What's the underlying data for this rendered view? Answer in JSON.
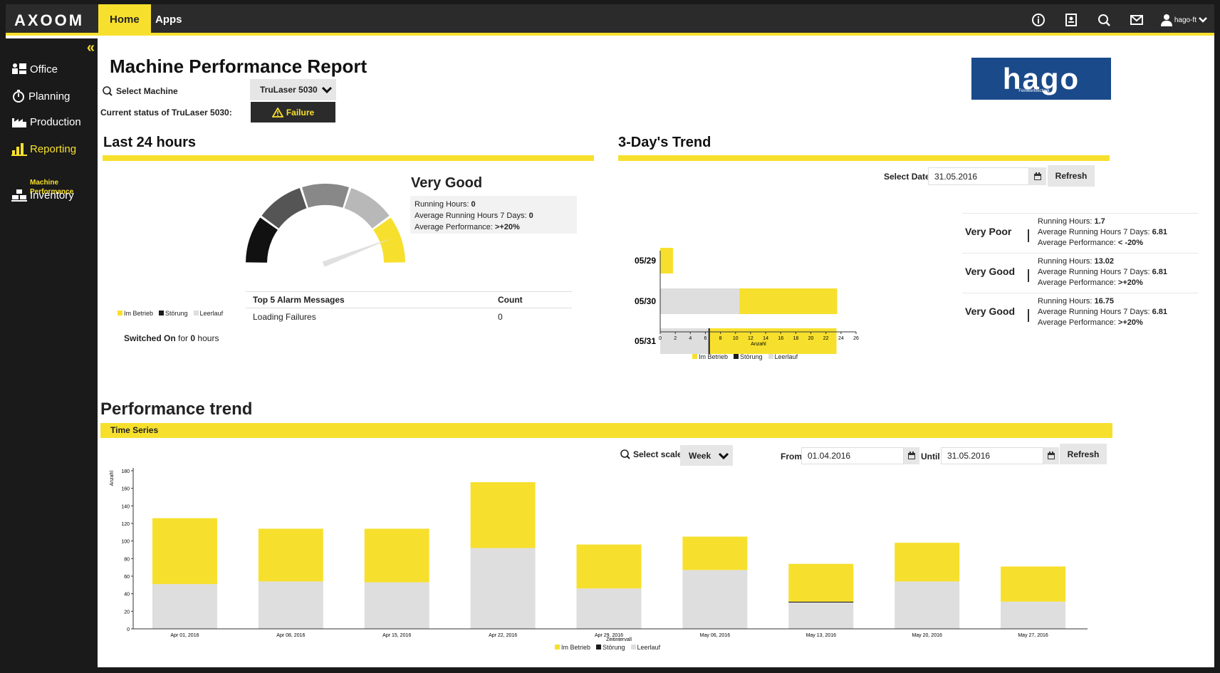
{
  "app": {
    "logo": "AXOOM"
  },
  "topnav": {
    "tabs": [
      {
        "label": "Home"
      },
      {
        "label": "Apps"
      }
    ],
    "username": "hago-ft"
  },
  "sidebar": {
    "items": [
      {
        "label": "Office",
        "icon": "office-icon"
      },
      {
        "label": "Planning",
        "icon": "stopwatch-icon"
      },
      {
        "label": "Production",
        "icon": "factory-icon"
      },
      {
        "label": "Reporting",
        "icon": "bar-chart-icon"
      },
      {
        "label": "Inventory",
        "icon": "inventory-icon"
      }
    ],
    "sub_item": "Machine Performance"
  },
  "page": {
    "title": "Machine Performance Report",
    "select_machine_label": "Select Machine",
    "machine_value": "TruLaser 5030",
    "status_label": "Current status of TruLaser 5030:",
    "status_value": "Failure",
    "brand_logo": "hago",
    "brand_sub": "Feinwerktechnik"
  },
  "last24": {
    "heading": "Last 24 hours",
    "rating": "Very Good",
    "running_hours_label": "Running Hours:",
    "running_hours": "0",
    "avg_7days_label": "Average Running Hours 7 Days:",
    "avg_7days": "0",
    "avg_perf_label": "Average Performance:",
    "avg_perf": ">+20%",
    "gauge_value": 0.95,
    "legend": [
      "Im Betrieb",
      "Störung",
      "Leerlauf"
    ],
    "switched_on_prefix": "Switched On",
    "switched_on_mid": "for",
    "switched_on_hours": "0",
    "switched_on_suffix": "hours",
    "alarm_table": {
      "headers": [
        "Top 5 Alarm Messages",
        "Count"
      ],
      "rows": [
        [
          "Loading Failures",
          "0"
        ]
      ]
    }
  },
  "trend3": {
    "heading": "3-Day's Trend",
    "select_date_label": "Select Date",
    "date_value": "31.05.2016",
    "refresh": "Refresh",
    "xlabel": "Anzahl",
    "legend": [
      "Im Betrieb",
      "Störung",
      "Leerlauf"
    ],
    "rows": [
      {
        "rating": "Very Poor",
        "running_label": "Running Hours:",
        "running": "1.7",
        "avg_label": "Average Running Hours 7 Days:",
        "avg": "6.81",
        "perf_label": "Average Performance:",
        "perf": "< -20%"
      },
      {
        "rating": "Very Good",
        "running_label": "Running Hours:",
        "running": "13.02",
        "avg_label": "Average Running Hours 7 Days:",
        "avg": "6.81",
        "perf_label": "Average Performance:",
        "perf": ">+20%"
      },
      {
        "rating": "Very Good",
        "running_label": "Running Hours:",
        "running": "16.75",
        "avg_label": "Average Running Hours 7 Days:",
        "avg": "6.81",
        "perf_label": "Average Performance:",
        "perf": ">+20%"
      }
    ]
  },
  "performance": {
    "heading": "Performance trend",
    "bar_label": "Time Series",
    "select_scale_label": "Select scale",
    "scale_value": "Week",
    "from_label": "From",
    "from_value": "01.04.2016",
    "until_label": "Until",
    "until_value": "31.05.2016",
    "refresh": "Refresh",
    "ylabel": "Anzahl",
    "xlabel": "Zeitintervall",
    "legend": [
      "Im Betrieb",
      "Störung",
      "Leerlauf"
    ]
  },
  "colors": {
    "accent": "#f7e02d",
    "dark": "#2b2b2b",
    "stoerung": "#1a1a1a",
    "leerlauf": "#dedede",
    "brand": "#1a4a8a"
  },
  "chart_data": [
    {
      "type": "bar",
      "orientation": "horizontal",
      "stacked": true,
      "categories": [
        "05/29",
        "05/30",
        "05/31"
      ],
      "series": [
        {
          "name": "Leerlauf",
          "values": [
            0,
            10.5,
            6.4
          ]
        },
        {
          "name": "Störung",
          "values": [
            0,
            0,
            0.2
          ]
        },
        {
          "name": "Im Betrieb",
          "values": [
            1.7,
            13.0,
            16.8
          ]
        }
      ],
      "xlabel": "Anzahl",
      "xlim": [
        0,
        26
      ],
      "xticks": [
        0,
        2,
        4,
        6,
        8,
        10,
        12,
        14,
        16,
        18,
        20,
        22,
        24,
        26
      ]
    },
    {
      "type": "bar",
      "stacked": true,
      "categories": [
        "Apr 01, 2016",
        "Apr 08, 2016",
        "Apr 15, 2016",
        "Apr 22, 2016",
        "Apr 29, 2016",
        "May 06, 2016",
        "May 13, 2016",
        "May 20, 2016",
        "May 27, 2016"
      ],
      "series": [
        {
          "name": "Leerlauf",
          "values": [
            51,
            54,
            53,
            92,
            46,
            67,
            30,
            54,
            31
          ]
        },
        {
          "name": "Störung",
          "values": [
            0,
            0,
            0,
            0,
            0,
            0,
            1,
            0,
            0
          ]
        },
        {
          "name": "Im Betrieb",
          "values": [
            75,
            60,
            61,
            75,
            50,
            38,
            43,
            44,
            40
          ]
        }
      ],
      "xlabel": "Zeitintervall",
      "ylabel": "Anzahl",
      "ylim": [
        0,
        180
      ],
      "yticks": [
        0,
        20,
        40,
        60,
        80,
        100,
        120,
        140,
        160,
        180
      ]
    }
  ]
}
